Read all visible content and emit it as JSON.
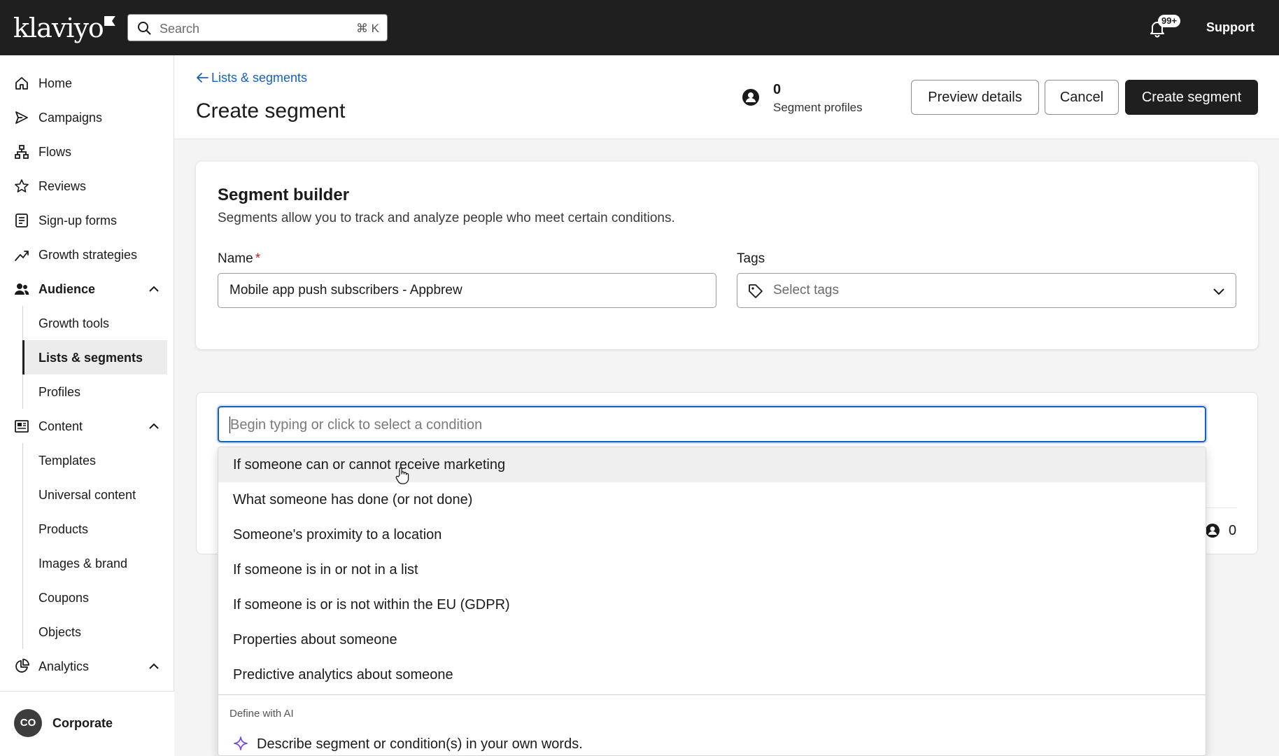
{
  "topbar": {
    "logo": "klaviyo",
    "search_placeholder": "Search",
    "search_shortcut": "⌘ K",
    "notification_badge": "99+",
    "support_label": "Support"
  },
  "sidebar": {
    "items": [
      {
        "label": "Home"
      },
      {
        "label": "Campaigns"
      },
      {
        "label": "Flows"
      },
      {
        "label": "Reviews"
      },
      {
        "label": "Sign-up forms"
      },
      {
        "label": "Growth strategies"
      },
      {
        "label": "Audience"
      },
      {
        "label": "Growth tools"
      },
      {
        "label": "Lists & segments"
      },
      {
        "label": "Profiles"
      },
      {
        "label": "Content"
      },
      {
        "label": "Templates"
      },
      {
        "label": "Universal content"
      },
      {
        "label": "Products"
      },
      {
        "label": "Images & brand"
      },
      {
        "label": "Coupons"
      },
      {
        "label": "Objects"
      },
      {
        "label": "Analytics"
      }
    ],
    "account_initials": "CO",
    "account_name": "Corporate"
  },
  "header": {
    "breadcrumb": "Lists & segments",
    "title": "Create segment",
    "profile_count": "0",
    "profile_label": "Segment profiles",
    "preview_button": "Preview details",
    "cancel_button": "Cancel",
    "create_button": "Create segment"
  },
  "builder": {
    "title": "Segment builder",
    "subtitle": "Segments allow you to track and analyze people who meet certain conditions.",
    "name_label": "Name",
    "required_mark": "*",
    "name_value": "Mobile app push subscribers - Appbrew",
    "tags_label": "Tags",
    "tags_placeholder": "Select tags"
  },
  "conditions": {
    "input_placeholder": "Begin typing or click to select a condition",
    "count": "0",
    "options": [
      "If someone can or cannot receive marketing",
      "What someone has done (or not done)",
      "Someone's proximity to a location",
      "If someone is in or not in a list",
      "If someone is or is not within the EU (GDPR)",
      "Properties about someone",
      "Predictive analytics about someone"
    ],
    "ai_heading": "Define with AI",
    "ai_option": "Describe segment or condition(s) in your own words."
  },
  "colors": {
    "topbar": "#1f1f1f",
    "link": "#1460c7",
    "required": "#d0212f",
    "ai_accent": "#7b4fd6"
  }
}
